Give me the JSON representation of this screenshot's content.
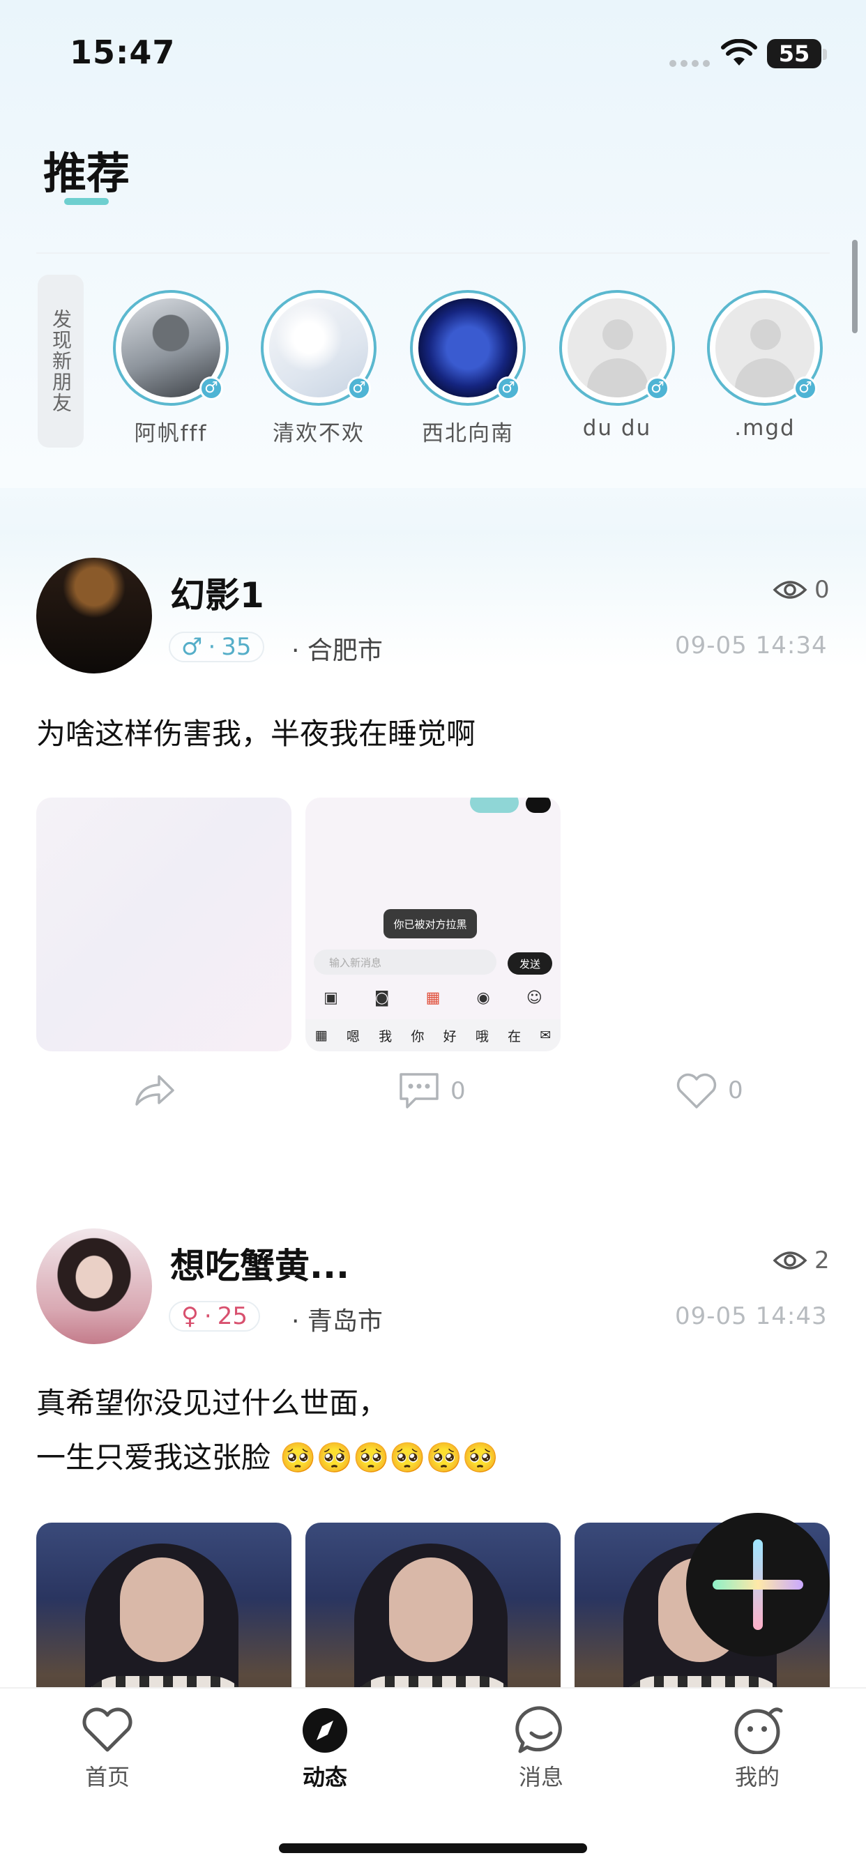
{
  "status_bar": {
    "time": "15:47",
    "battery": "55"
  },
  "header": {
    "title": "推荐"
  },
  "discover": {
    "tag": "发现新朋友",
    "friends": [
      {
        "name": "阿帆fff",
        "gender": "♂"
      },
      {
        "name": "清欢不欢",
        "gender": "♂"
      },
      {
        "name": "西北向南",
        "gender": "♂"
      },
      {
        "name": "du du",
        "gender": "♂"
      },
      {
        "name": ".mgd",
        "gender": "♂"
      }
    ]
  },
  "posts": [
    {
      "name": "幻影1",
      "views": "0",
      "gender": "♂",
      "age": "35",
      "city": "合肥市",
      "time": "09-05 14:34",
      "text": "为啥这样伤害我，半夜我在睡觉啊",
      "comments": "0",
      "likes": "0",
      "chat_screenshot": {
        "toast": "你已被对方拉黑",
        "input_placeholder": "输入新消息",
        "send": "发送",
        "keys": [
          "嗯",
          "我",
          "你",
          "好",
          "哦",
          "在"
        ]
      }
    },
    {
      "name": "想吃蟹黄...",
      "views": "2",
      "gender": "♀",
      "age": "25",
      "city": "青岛市",
      "time": "09-05 14:43",
      "text_line1": "真希望你没见过什么世面，",
      "text_line2": "一生只爱我这张脸 🥺🥺🥺🥺🥺🥺"
    }
  ],
  "tabs": [
    {
      "label": "首页",
      "icon": "heart-icon"
    },
    {
      "label": "动态",
      "icon": "compass-icon"
    },
    {
      "label": "消息",
      "icon": "chat-smile-icon"
    },
    {
      "label": "我的",
      "icon": "face-icon"
    }
  ],
  "colors": {
    "accent": "#6ecfcf",
    "male": "#55aec8",
    "female": "#d8506e"
  }
}
